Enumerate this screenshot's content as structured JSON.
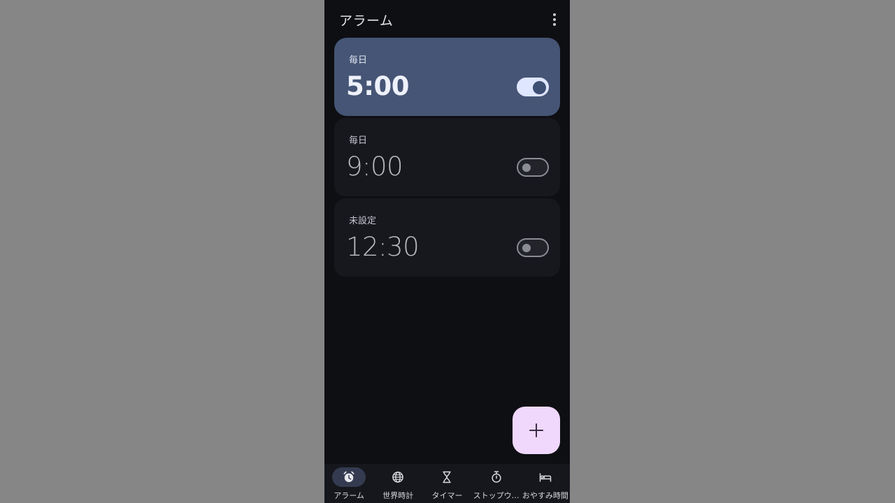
{
  "header": {
    "title": "アラーム"
  },
  "alarms": [
    {
      "days": "毎日",
      "time": "5:00",
      "enabled": true
    },
    {
      "days": "毎日",
      "time": "9:00",
      "enabled": false
    },
    {
      "days": "未設定",
      "time": "12:30",
      "enabled": false
    }
  ],
  "fab": {
    "icon": "plus-icon"
  },
  "nav": [
    {
      "label": "アラーム",
      "icon": "alarm-clock-icon",
      "selected": true
    },
    {
      "label": "世界時計",
      "icon": "globe-icon",
      "selected": false
    },
    {
      "label": "タイマー",
      "icon": "hourglass-icon",
      "selected": false
    },
    {
      "label": "ストップウ…",
      "icon": "stopwatch-icon",
      "selected": false
    },
    {
      "label": "おやすみ時間",
      "icon": "bed-icon",
      "selected": false
    }
  ],
  "colors": {
    "background": "#0e0f13",
    "active_card": "#465575",
    "fab": "#f0d8fc"
  }
}
